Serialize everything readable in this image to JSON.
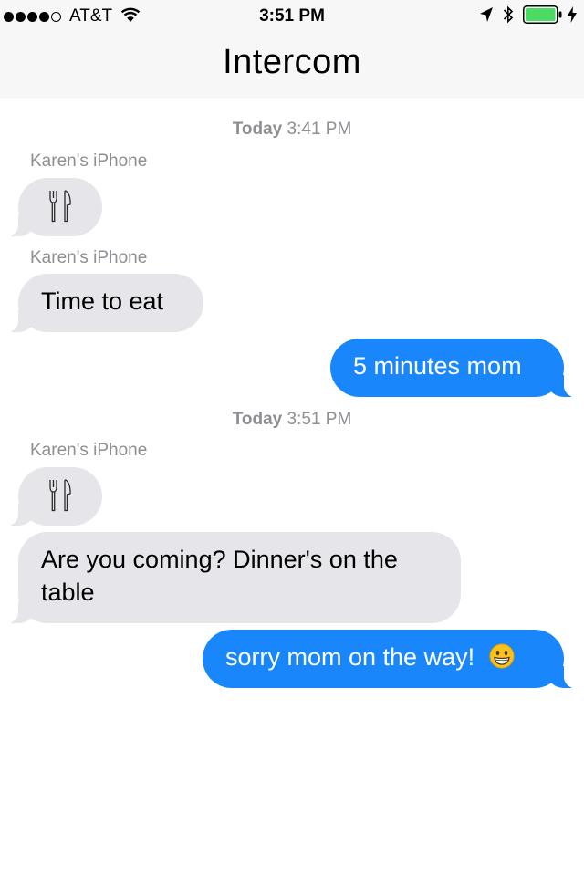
{
  "status_bar": {
    "carrier": "AT&T",
    "time": "3:51 PM",
    "signal_bars_filled": 4,
    "signal_bars_total": 5,
    "battery_level": 1.0,
    "icons": [
      "signal-dots",
      "wifi-icon",
      "location-arrow-icon",
      "bluetooth-icon",
      "battery-icon",
      "charging-bolt-icon"
    ]
  },
  "nav": {
    "title": "Intercom"
  },
  "conversation": {
    "timestamp_1": {
      "day": "Today",
      "time": "3:41 PM"
    },
    "timestamp_2": {
      "day": "Today",
      "time": "3:51 PM"
    },
    "messages": [
      {
        "sender": "Karen's iPhone",
        "direction": "incoming",
        "content": "fork-and-knife-icon"
      },
      {
        "sender": "Karen's iPhone",
        "direction": "incoming",
        "text": "Time to eat"
      },
      {
        "direction": "outgoing",
        "text": "5 minutes mom"
      },
      {
        "sender": "Karen's iPhone",
        "direction": "incoming",
        "content": "fork-and-knife-icon"
      },
      {
        "direction": "incoming",
        "text_line_1": "Are you coming? Dinner's on the",
        "text_line_2": "table"
      },
      {
        "direction": "outgoing",
        "text": "sorry mom on the way!",
        "emoji": "grinning-face-icon"
      }
    ]
  },
  "colors": {
    "incoming_bubble": "#e5e5ea",
    "outgoing_bubble": "#1a86fc",
    "meta_text": "#8e8e93",
    "battery_fill": "#4cd964"
  }
}
